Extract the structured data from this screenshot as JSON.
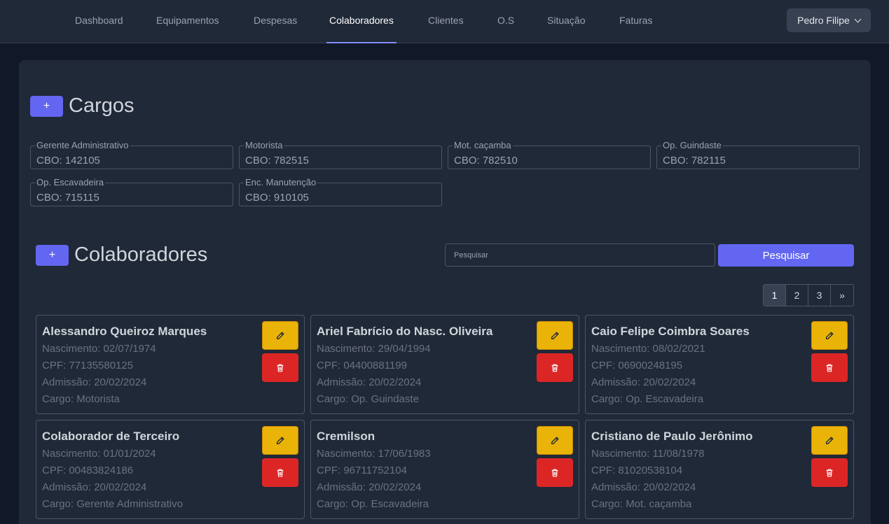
{
  "nav": {
    "items": [
      "Dashboard",
      "Equipamentos",
      "Despesas",
      "Colaboradores",
      "Clientes",
      "O.S",
      "Situação",
      "Faturas"
    ],
    "active": "Colaboradores",
    "user": "Pedro Filipe"
  },
  "cargos": {
    "title": "Cargos",
    "add_label": "+",
    "items": [
      {
        "name": "Gerente Administrativo",
        "cbo": "CBO: 142105"
      },
      {
        "name": "Motorista",
        "cbo": "CBO: 782515"
      },
      {
        "name": "Mot. caçamba",
        "cbo": "CBO: 782510"
      },
      {
        "name": "Op. Guindaste",
        "cbo": "CBO: 782115"
      },
      {
        "name": "Op. Escavadeira",
        "cbo": "CBO: 715115"
      },
      {
        "name": "Enc. Manutenção",
        "cbo": "CBO: 910105"
      }
    ]
  },
  "colaboradores": {
    "title": "Colaboradores",
    "add_label": "+",
    "search_placeholder": "Pesquisar",
    "search_button": "Pesquisar",
    "pagination": [
      "1",
      "2",
      "3",
      "»"
    ],
    "current_page": "1",
    "cards": [
      {
        "name": "Alessandro Queiroz Marques",
        "nascimento": "Nascimento: 02/07/1974",
        "cpf": "CPF: 77135580125",
        "admissao": "Admissão: 20/02/2024",
        "cargo": "Cargo: Motorista"
      },
      {
        "name": "Ariel Fabrício do Nasc. Oliveira",
        "nascimento": "Nascimento: 29/04/1994",
        "cpf": "CPF: 04400881199",
        "admissao": "Admissão: 20/02/2024",
        "cargo": "Cargo: Op. Guindaste"
      },
      {
        "name": "Caio Felipe Coimbra Soares",
        "nascimento": "Nascimento: 08/02/2021",
        "cpf": "CPF: 06900248195",
        "admissao": "Admissão: 20/02/2024",
        "cargo": "Cargo: Op. Escavadeira"
      },
      {
        "name": "Colaborador de Terceiro",
        "nascimento": "Nascimento: 01/01/2024",
        "cpf": "CPF: 00483824186",
        "admissao": "Admissão: 20/02/2024",
        "cargo": "Cargo: Gerente Administrativo"
      },
      {
        "name": "Cremilson",
        "nascimento": "Nascimento: 17/06/1983",
        "cpf": "CPF: 96711752104",
        "admissao": "Admissão: 20/02/2024",
        "cargo": "Cargo: Op. Escavadeira"
      },
      {
        "name": "Cristiano de Paulo Jerônimo",
        "nascimento": "Nascimento: 11/08/1978",
        "cpf": "CPF: 81020538104",
        "admissao": "Admissão: 20/02/2024",
        "cargo": "Cargo: Mot. caçamba"
      }
    ]
  },
  "icons": {
    "edit": "pencil-icon",
    "delete": "trash-icon",
    "dropdown": "chevron-down-icon"
  },
  "colors": {
    "accent": "#6366f1",
    "edit": "#eab308",
    "delete": "#dc2626",
    "background": "#111827",
    "panel": "#1f2937"
  }
}
